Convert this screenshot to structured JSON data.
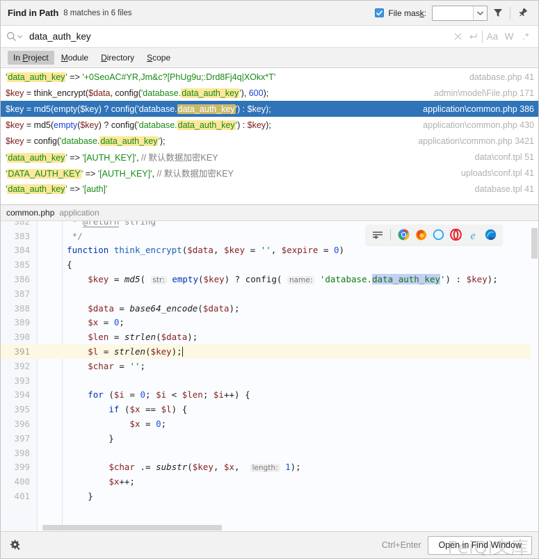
{
  "header": {
    "title": "Find in Path",
    "summary": "8 matches in 6 files",
    "file_mask_label": "File mask:",
    "file_mask_value": "",
    "file_mask_checked": true,
    "filter_icon": "filter-funnel-icon",
    "pin_icon": "pin-icon"
  },
  "search": {
    "query": "data_auth_key",
    "placeholder": "",
    "clear_label": "×",
    "history_label": "↲",
    "match_case_label": "Aa",
    "words_label": "W",
    "regex_label": ".*"
  },
  "scope_tabs": [
    {
      "label": "In Project",
      "underline": "P",
      "active": true
    },
    {
      "label": "Module",
      "underline": "M",
      "active": false
    },
    {
      "label": "Directory",
      "underline": "D",
      "active": false
    },
    {
      "label": "Scope",
      "underline": "S",
      "active": false
    }
  ],
  "results": [
    {
      "location": "database.php 41",
      "selected": false,
      "tokens": [
        {
          "t": "'",
          "c": "str"
        },
        {
          "t": "data_auth_key",
          "c": "str",
          "hl": true
        },
        {
          "t": "'",
          "c": "str"
        },
        {
          "t": " => ",
          "c": "pl"
        },
        {
          "t": "'+0SeoAC#YR,Jm&c?[PhUg9u;:Drd8Fj4q|XOkx*T'",
          "c": "str"
        }
      ]
    },
    {
      "location": "admin\\model\\File.php 171",
      "selected": false,
      "tokens": [
        {
          "t": "$key",
          "c": "var"
        },
        {
          "t": " = think_encrypt(",
          "c": "pl"
        },
        {
          "t": "$data",
          "c": "var"
        },
        {
          "t": ", config(",
          "c": "pl"
        },
        {
          "t": "'database.",
          "c": "str"
        },
        {
          "t": "data_auth_key",
          "c": "str",
          "hl": true
        },
        {
          "t": "'",
          "c": "str"
        },
        {
          "t": "), ",
          "c": "pl"
        },
        {
          "t": "600",
          "c": "num"
        },
        {
          "t": ");",
          "c": "pl"
        }
      ]
    },
    {
      "location": "application\\common.php 386",
      "selected": true,
      "tokens": [
        {
          "t": "$key",
          "c": "var"
        },
        {
          "t": " = md5(empty(",
          "c": "pl"
        },
        {
          "t": "$key",
          "c": "var"
        },
        {
          "t": ") ? config(",
          "c": "pl"
        },
        {
          "t": "'database.",
          "c": "str"
        },
        {
          "t": "data_auth_key",
          "c": "str",
          "hl": true
        },
        {
          "t": "'",
          "c": "str"
        },
        {
          "t": ") : ",
          "c": "pl"
        },
        {
          "t": "$key",
          "c": "var"
        },
        {
          "t": ");",
          "c": "pl"
        }
      ]
    },
    {
      "location": "application\\common.php 430",
      "selected": false,
      "tokens": [
        {
          "t": "$key",
          "c": "var"
        },
        {
          "t": " = md5(",
          "c": "pl"
        },
        {
          "t": "empty",
          "c": "kw"
        },
        {
          "t": "(",
          "c": "pl"
        },
        {
          "t": "$key",
          "c": "var"
        },
        {
          "t": ") ? config(",
          "c": "pl"
        },
        {
          "t": "'database.",
          "c": "str"
        },
        {
          "t": "data_auth_key",
          "c": "str",
          "hl": true
        },
        {
          "t": "'",
          "c": "str"
        },
        {
          "t": ") : ",
          "c": "pl"
        },
        {
          "t": "$key",
          "c": "var"
        },
        {
          "t": ");",
          "c": "pl"
        }
      ]
    },
    {
      "location": "application\\common.php 3421",
      "selected": false,
      "tokens": [
        {
          "t": "$key",
          "c": "var"
        },
        {
          "t": " = config(",
          "c": "pl"
        },
        {
          "t": "'database.",
          "c": "str"
        },
        {
          "t": "data_auth_key",
          "c": "str",
          "hl": true
        },
        {
          "t": "'",
          "c": "str"
        },
        {
          "t": ");",
          "c": "pl"
        }
      ]
    },
    {
      "location": "data\\conf.tpl 51",
      "selected": false,
      "tokens": [
        {
          "t": "'",
          "c": "str"
        },
        {
          "t": "data_auth_key",
          "c": "str",
          "hl": true
        },
        {
          "t": "'",
          "c": "str"
        },
        {
          "t": " => ",
          "c": "pl"
        },
        {
          "t": "'[AUTH_KEY]'",
          "c": "str"
        },
        {
          "t": ", ",
          "c": "pl"
        },
        {
          "t": "// 默认数据加密KEY",
          "c": "cmt"
        }
      ]
    },
    {
      "location": "uploads\\conf.tpl 41",
      "selected": false,
      "tokens": [
        {
          "t": "'",
          "c": "str"
        },
        {
          "t": "DATA_AUTH_KEY",
          "c": "str",
          "hl": true
        },
        {
          "t": "'",
          "c": "str"
        },
        {
          "t": " => ",
          "c": "pl"
        },
        {
          "t": "'[AUTH_KEY]'",
          "c": "str"
        },
        {
          "t": ", ",
          "c": "pl"
        },
        {
          "t": "// 默认数据加密KEY",
          "c": "cmt"
        }
      ]
    },
    {
      "location": "database.tpl 41",
      "selected": false,
      "tokens": [
        {
          "t": "'",
          "c": "str"
        },
        {
          "t": "data_auth_key",
          "c": "str",
          "hl": true
        },
        {
          "t": "'",
          "c": "str"
        },
        {
          "t": " => ",
          "c": "pl"
        },
        {
          "t": "'[auth]'",
          "c": "str"
        }
      ]
    }
  ],
  "preview": {
    "file_name": "common.php",
    "file_path": "application",
    "browser_icons": [
      "soft-wrap-icon",
      "chrome-icon",
      "firefox-icon",
      "safari-icon",
      "opera-icon",
      "internet-explorer-icon",
      "edge-icon"
    ],
    "lines": [
      {
        "num": "382",
        "clipped": true,
        "tokens": [
          {
            "t": "     * ",
            "c": "cmt"
          },
          {
            "t": "@return",
            "c": "cmt-b"
          },
          {
            "t": " string",
            "c": "cmt"
          }
        ]
      },
      {
        "num": "383",
        "tokens": [
          {
            "t": "     */",
            "c": "cmt"
          }
        ]
      },
      {
        "num": "384",
        "tokens": [
          {
            "t": "    ",
            "c": "pl"
          },
          {
            "t": "function",
            "c": "kw"
          },
          {
            "t": " ",
            "c": "pl"
          },
          {
            "t": "think_encrypt",
            "c": "fn"
          },
          {
            "t": "(",
            "c": "pl"
          },
          {
            "t": "$data",
            "c": "var"
          },
          {
            "t": ", ",
            "c": "pl"
          },
          {
            "t": "$key",
            "c": "var"
          },
          {
            "t": " = ",
            "c": "pl"
          },
          {
            "t": "''",
            "c": "str"
          },
          {
            "t": ", ",
            "c": "pl"
          },
          {
            "t": "$expire",
            "c": "var"
          },
          {
            "t": " = ",
            "c": "pl"
          },
          {
            "t": "0",
            "c": "num"
          },
          {
            "t": ")",
            "c": "pl"
          }
        ]
      },
      {
        "num": "385",
        "tokens": [
          {
            "t": "    {",
            "c": "pl"
          }
        ]
      },
      {
        "num": "386",
        "tokens": [
          {
            "t": "        ",
            "c": "pl"
          },
          {
            "t": "$key",
            "c": "var"
          },
          {
            "t": " = ",
            "c": "pl"
          },
          {
            "t": "md5",
            "c": "ital"
          },
          {
            "t": "( ",
            "c": "pl"
          },
          {
            "t": "str:",
            "c": "hint"
          },
          {
            "t": " ",
            "c": "pl"
          },
          {
            "t": "empty",
            "c": "kw"
          },
          {
            "t": "(",
            "c": "pl"
          },
          {
            "t": "$key",
            "c": "var"
          },
          {
            "t": ") ? ",
            "c": "pl"
          },
          {
            "t": "config",
            "c": "pl"
          },
          {
            "t": "( ",
            "c": "pl"
          },
          {
            "t": "name:",
            "c": "hint"
          },
          {
            "t": " ",
            "c": "pl"
          },
          {
            "t": "'database.",
            "c": "str"
          },
          {
            "t": "data_auth_key",
            "c": "str",
            "sel": true
          },
          {
            "t": "'",
            "c": "str"
          },
          {
            "t": ") : ",
            "c": "pl"
          },
          {
            "t": "$key",
            "c": "var"
          },
          {
            "t": ");",
            "c": "pl"
          }
        ]
      },
      {
        "num": "387",
        "tokens": []
      },
      {
        "num": "388",
        "tokens": [
          {
            "t": "        ",
            "c": "pl"
          },
          {
            "t": "$data",
            "c": "var"
          },
          {
            "t": " = ",
            "c": "pl"
          },
          {
            "t": "base64_encode",
            "c": "ital"
          },
          {
            "t": "(",
            "c": "pl"
          },
          {
            "t": "$data",
            "c": "var"
          },
          {
            "t": ");",
            "c": "pl"
          }
        ]
      },
      {
        "num": "389",
        "tokens": [
          {
            "t": "        ",
            "c": "pl"
          },
          {
            "t": "$x",
            "c": "var"
          },
          {
            "t": " = ",
            "c": "pl"
          },
          {
            "t": "0",
            "c": "num"
          },
          {
            "t": ";",
            "c": "pl"
          }
        ]
      },
      {
        "num": "390",
        "tokens": [
          {
            "t": "        ",
            "c": "pl"
          },
          {
            "t": "$len",
            "c": "var"
          },
          {
            "t": " = ",
            "c": "pl"
          },
          {
            "t": "strlen",
            "c": "ital"
          },
          {
            "t": "(",
            "c": "pl"
          },
          {
            "t": "$data",
            "c": "var"
          },
          {
            "t": ");",
            "c": "pl"
          }
        ]
      },
      {
        "num": "391",
        "current": true,
        "caret": true,
        "tokens": [
          {
            "t": "        ",
            "c": "pl"
          },
          {
            "t": "$l",
            "c": "var"
          },
          {
            "t": " = ",
            "c": "pl"
          },
          {
            "t": "strlen",
            "c": "ital"
          },
          {
            "t": "(",
            "c": "pl"
          },
          {
            "t": "$key",
            "c": "var"
          },
          {
            "t": ");",
            "c": "pl"
          }
        ]
      },
      {
        "num": "392",
        "tokens": [
          {
            "t": "        ",
            "c": "pl"
          },
          {
            "t": "$char",
            "c": "var"
          },
          {
            "t": " = ",
            "c": "pl"
          },
          {
            "t": "''",
            "c": "str"
          },
          {
            "t": ";",
            "c": "pl"
          }
        ]
      },
      {
        "num": "393",
        "tokens": []
      },
      {
        "num": "394",
        "tokens": [
          {
            "t": "        ",
            "c": "pl"
          },
          {
            "t": "for",
            "c": "kw"
          },
          {
            "t": " (",
            "c": "pl"
          },
          {
            "t": "$i",
            "c": "var"
          },
          {
            "t": " = ",
            "c": "pl"
          },
          {
            "t": "0",
            "c": "num"
          },
          {
            "t": "; ",
            "c": "pl"
          },
          {
            "t": "$i",
            "c": "var"
          },
          {
            "t": " < ",
            "c": "pl"
          },
          {
            "t": "$len",
            "c": "var"
          },
          {
            "t": "; ",
            "c": "pl"
          },
          {
            "t": "$i",
            "c": "var"
          },
          {
            "t": "++) {",
            "c": "pl"
          }
        ]
      },
      {
        "num": "395",
        "tokens": [
          {
            "t": "            ",
            "c": "pl"
          },
          {
            "t": "if",
            "c": "kw"
          },
          {
            "t": " (",
            "c": "pl"
          },
          {
            "t": "$x",
            "c": "var"
          },
          {
            "t": " == ",
            "c": "pl"
          },
          {
            "t": "$l",
            "c": "var"
          },
          {
            "t": ") {",
            "c": "pl"
          }
        ]
      },
      {
        "num": "396",
        "tokens": [
          {
            "t": "                ",
            "c": "pl"
          },
          {
            "t": "$x",
            "c": "var"
          },
          {
            "t": " = ",
            "c": "pl"
          },
          {
            "t": "0",
            "c": "num"
          },
          {
            "t": ";",
            "c": "pl"
          }
        ]
      },
      {
        "num": "397",
        "tokens": [
          {
            "t": "            }",
            "c": "pl"
          }
        ]
      },
      {
        "num": "398",
        "tokens": []
      },
      {
        "num": "399",
        "tokens": [
          {
            "t": "            ",
            "c": "pl"
          },
          {
            "t": "$char",
            "c": "var"
          },
          {
            "t": " .= ",
            "c": "pl"
          },
          {
            "t": "substr",
            "c": "ital"
          },
          {
            "t": "(",
            "c": "pl"
          },
          {
            "t": "$key",
            "c": "var"
          },
          {
            "t": ", ",
            "c": "pl"
          },
          {
            "t": "$x",
            "c": "var"
          },
          {
            "t": ",  ",
            "c": "pl"
          },
          {
            "t": "length:",
            "c": "hint"
          },
          {
            "t": " ",
            "c": "pl"
          },
          {
            "t": "1",
            "c": "num"
          },
          {
            "t": ");",
            "c": "pl"
          }
        ]
      },
      {
        "num": "400",
        "tokens": [
          {
            "t": "            ",
            "c": "pl"
          },
          {
            "t": "$x",
            "c": "var"
          },
          {
            "t": "++;",
            "c": "pl"
          }
        ]
      },
      {
        "num": "401",
        "tokens": [
          {
            "t": "        }",
            "c": "pl"
          }
        ]
      }
    ]
  },
  "footer": {
    "settings_icon": "gear-icon",
    "shortcut": "Ctrl+Enter",
    "open_button": "Open in Find Window",
    "watermark": "PeiQi文库"
  }
}
